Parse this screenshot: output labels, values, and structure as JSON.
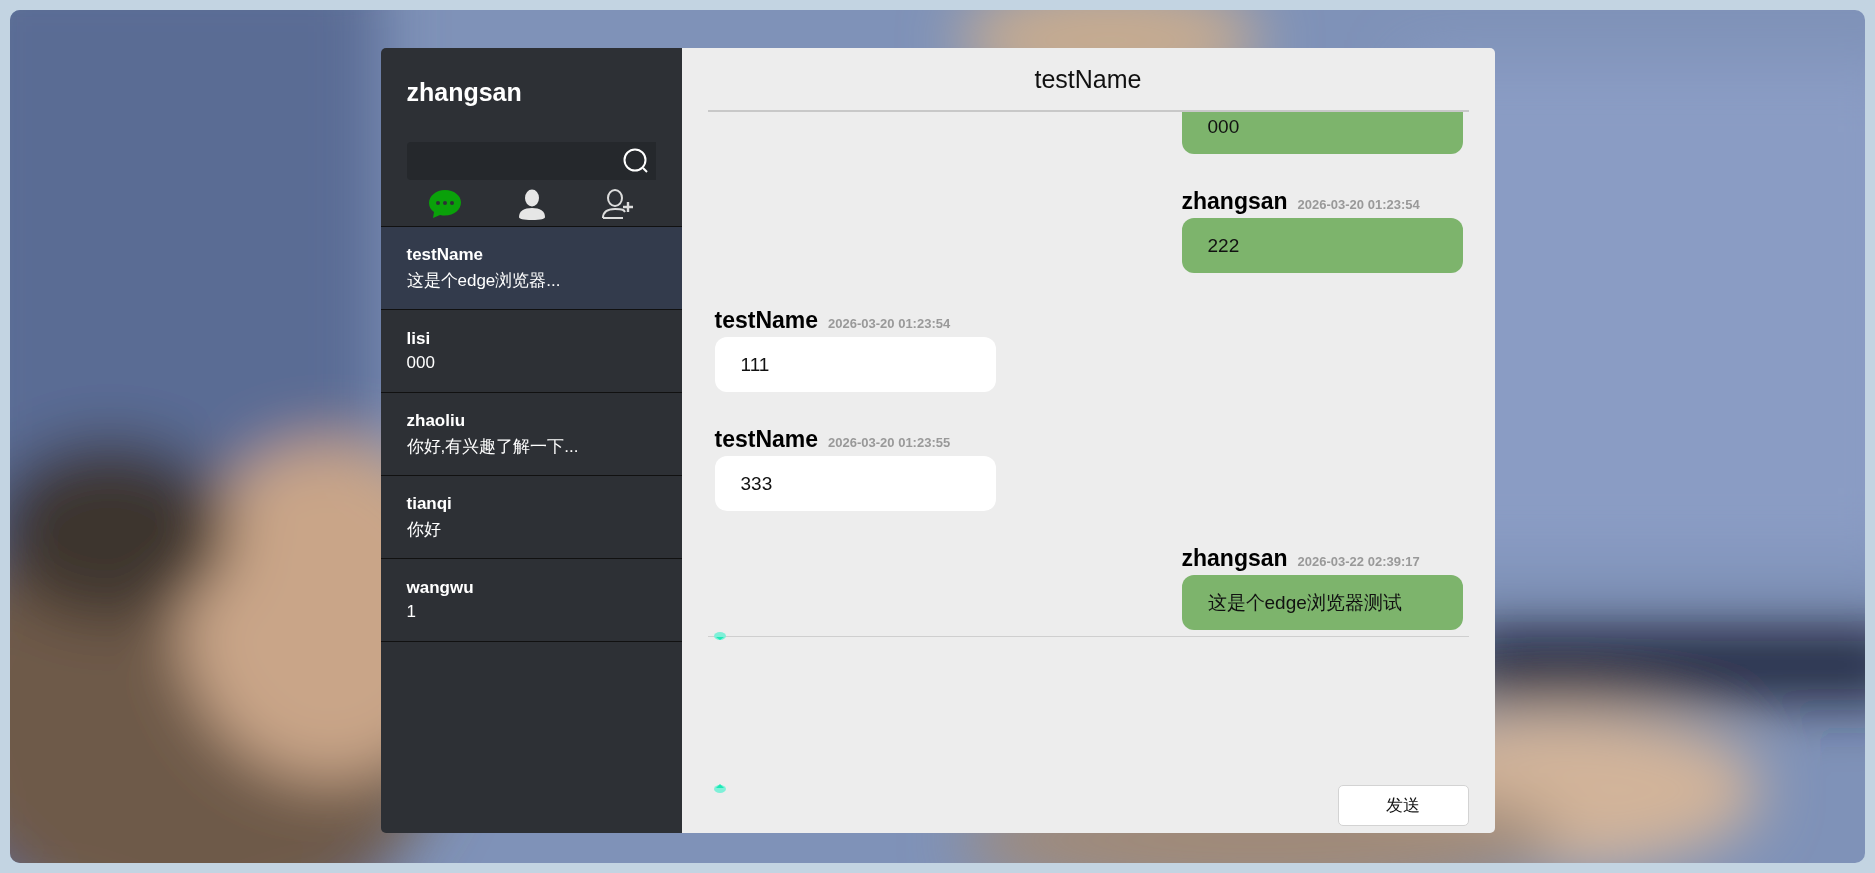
{
  "sidebar": {
    "user": "zhangsan",
    "tabs": [
      {
        "kind": "chat",
        "selected": true
      },
      {
        "kind": "contacts",
        "selected": false
      },
      {
        "kind": "add-friend",
        "selected": false
      }
    ],
    "conversations": [
      {
        "name": "testName",
        "preview": "这是个edge浏览器...",
        "selected": true
      },
      {
        "name": "lisi",
        "preview": "000",
        "selected": false
      },
      {
        "name": "zhaoliu",
        "preview": "你好,有兴趣了解一下...",
        "selected": false
      },
      {
        "name": "tianqi",
        "preview": "你好",
        "selected": false
      },
      {
        "name": "wangwu",
        "preview": "1",
        "selected": false
      }
    ]
  },
  "chat": {
    "title": "testName",
    "messages": [
      {
        "from_me": true,
        "text": "000"
      },
      {
        "from_me": true,
        "sender": "zhangsan",
        "time": "2026-03-20 01:23:54",
        "text": "222"
      },
      {
        "from_me": false,
        "sender": "testName",
        "time": "2026-03-20 01:23:54",
        "text": "111"
      },
      {
        "from_me": false,
        "sender": "testName",
        "time": "2026-03-20 01:23:55",
        "text": "333"
      },
      {
        "from_me": true,
        "sender": "zhangsan",
        "time": "2026-03-22 02:39:17",
        "text": "这是个edge浏览器测试"
      }
    ],
    "send_button": "发送"
  }
}
